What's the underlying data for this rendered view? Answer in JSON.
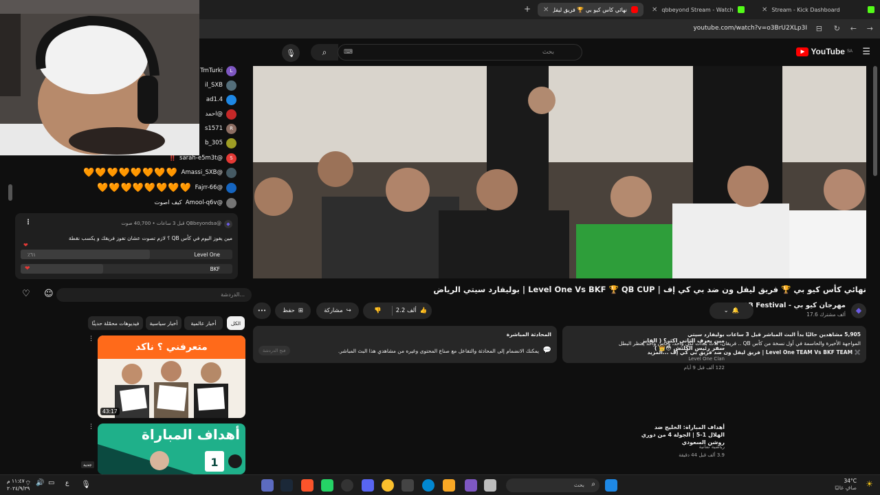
{
  "browser": {
    "tabs": [
      {
        "label": "Stream - Kick Dashboard"
      },
      {
        "label": "qbbeyond Stream - Watch"
      },
      {
        "label": "نهائي كأس كيو بي 🏆 فريق ليفل"
      }
    ],
    "new_tab": "+",
    "url": "youtube.com/watch?v=o3BrU2XLp3I"
  },
  "youtube": {
    "logo_text": "YouTube",
    "logo_region": "SA",
    "search_placeholder": "بحث",
    "video": {
      "title": "نهائي كأس كيو بي 🏆 فريق ليفل ون ضد بي كي إف | Level One Vs BKF 🏆 QB CUP | بوليفارد سيتي الرياض",
      "channel_name": "QB Festival - مهرجان كيو بي",
      "channel_subs": "17.6 ألف مشترك",
      "likes": "2.2 ألف",
      "share_label": "مشاركة",
      "save_label": "حفظ",
      "more_label": "•••"
    },
    "description": {
      "stats": "5,905 مشاهدين حاليًا  بدأ البث المباشر قبل 3 ساعات  بوليفارد سيتي",
      "line1": "المواجهة الأخيرة والحاسمة في أول نسخة من كأس QB .. فريقان، ثلاث بلدات لكل واحد، وكأس واحد ينتظر البطل",
      "line2": "✖️ Level One TEAM Vs BKF TEAM | فريق ليفل ون ضد فريق بي كي إف ...المزيد"
    },
    "live_chat": {
      "header": "المحادثة المباشرة",
      "text": "يمكنك الانضمام إلى المحادثة والتفاعل مع صناع المحتوى وغيره من مشاهدي هذا البث المباشر.",
      "button": "فتح الدردشة"
    },
    "chips": [
      "الكل",
      "أخبار عالمية",
      "أخبار سياسية",
      "فيديوهات محمّلة حديثًا"
    ],
    "recommended": [
      {
        "title": "مين يعرف الثاني اكثر؟ ( الفايز سفر رئيس الكلتش 😳👑 )",
        "channel": "Level One Clan",
        "meta": "122 ألف  قبل 9 أيام",
        "duration": "43:17",
        "thumb_text": "متعرفني ؟ ناكد"
      },
      {
        "title": "أهداف المباراة: الخليج ضد الهلال 1-5 | الجولة 4 من دوري روشن السعودي",
        "channel": "رياضية ثمانية",
        "meta": "3.9 ألف  قبل 44 دقيقة",
        "badge": "جديد",
        "thumb_text": "أهداف المباراة"
      }
    ]
  },
  "stream_chat": {
    "messages": [
      {
        "user": "TrnTurki",
        "text": "",
        "color": "#7e57c2"
      },
      {
        "user": "il_SXB",
        "text": "",
        "color": "#546e7a"
      },
      {
        "user": "ad1.4",
        "text": "",
        "color": "#1e88e5"
      },
      {
        "user": "@احمد",
        "text": "",
        "color": "#c62828"
      },
      {
        "user": "s1571",
        "text": "",
        "color": "#8d6e63"
      },
      {
        "user": "b_305",
        "text": "",
        "color": "#9e9d24"
      },
      {
        "user": "@sarah-e5m3t",
        "text": "‼️",
        "color": "#e53935"
      },
      {
        "user": "@Amassi_SXB",
        "text": "🧡🧡🧡🧡🧡🧡🧡🧡",
        "color": "#455a64"
      },
      {
        "user": "@Fajrr-66",
        "text": "🧡🧡🧡🧡🧡🧡🧡🧡",
        "color": "#1565c0"
      },
      {
        "user": "@Amool-q6v",
        "text": "كيف اصوت",
        "color": "#757575"
      }
    ],
    "poll": {
      "author": "@QBbeyondsa",
      "meta": "قبل 3 ساعات • 40,700 صوت",
      "question": "مين يفوز اليوم في كأس QB ؟ لازم تصوت عشان تفوز فريقك و يكسب نقطة",
      "options": [
        {
          "label": "Level One",
          "percent": "٪٦١",
          "value": 61
        },
        {
          "label": "BKF",
          "percent": "",
          "value": 39
        }
      ]
    },
    "input_placeholder": "الدردشة..."
  },
  "taskbar": {
    "search_placeholder": "بحث",
    "time": "١١:٤٧ م",
    "date": "٢٠٢٤/٩/٢٩",
    "weather_temp": "34°C",
    "weather_desc": "صافٍ غالبًا",
    "lang": "ع"
  }
}
